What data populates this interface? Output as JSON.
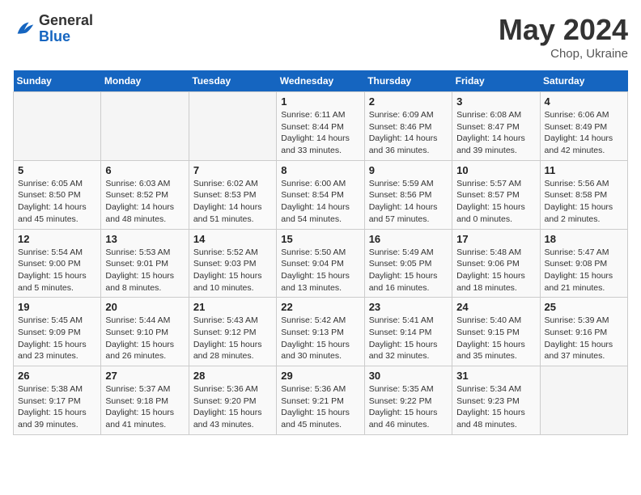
{
  "logo": {
    "line1": "General",
    "line2": "Blue"
  },
  "title": "May 2024",
  "location": "Chop, Ukraine",
  "weekdays": [
    "Sunday",
    "Monday",
    "Tuesday",
    "Wednesday",
    "Thursday",
    "Friday",
    "Saturday"
  ],
  "weeks": [
    [
      {
        "day": "",
        "info": ""
      },
      {
        "day": "",
        "info": ""
      },
      {
        "day": "",
        "info": ""
      },
      {
        "day": "1",
        "info": "Sunrise: 6:11 AM\nSunset: 8:44 PM\nDaylight: 14 hours\nand 33 minutes."
      },
      {
        "day": "2",
        "info": "Sunrise: 6:09 AM\nSunset: 8:46 PM\nDaylight: 14 hours\nand 36 minutes."
      },
      {
        "day": "3",
        "info": "Sunrise: 6:08 AM\nSunset: 8:47 PM\nDaylight: 14 hours\nand 39 minutes."
      },
      {
        "day": "4",
        "info": "Sunrise: 6:06 AM\nSunset: 8:49 PM\nDaylight: 14 hours\nand 42 minutes."
      }
    ],
    [
      {
        "day": "5",
        "info": "Sunrise: 6:05 AM\nSunset: 8:50 PM\nDaylight: 14 hours\nand 45 minutes."
      },
      {
        "day": "6",
        "info": "Sunrise: 6:03 AM\nSunset: 8:52 PM\nDaylight: 14 hours\nand 48 minutes."
      },
      {
        "day": "7",
        "info": "Sunrise: 6:02 AM\nSunset: 8:53 PM\nDaylight: 14 hours\nand 51 minutes."
      },
      {
        "day": "8",
        "info": "Sunrise: 6:00 AM\nSunset: 8:54 PM\nDaylight: 14 hours\nand 54 minutes."
      },
      {
        "day": "9",
        "info": "Sunrise: 5:59 AM\nSunset: 8:56 PM\nDaylight: 14 hours\nand 57 minutes."
      },
      {
        "day": "10",
        "info": "Sunrise: 5:57 AM\nSunset: 8:57 PM\nDaylight: 15 hours\nand 0 minutes."
      },
      {
        "day": "11",
        "info": "Sunrise: 5:56 AM\nSunset: 8:58 PM\nDaylight: 15 hours\nand 2 minutes."
      }
    ],
    [
      {
        "day": "12",
        "info": "Sunrise: 5:54 AM\nSunset: 9:00 PM\nDaylight: 15 hours\nand 5 minutes."
      },
      {
        "day": "13",
        "info": "Sunrise: 5:53 AM\nSunset: 9:01 PM\nDaylight: 15 hours\nand 8 minutes."
      },
      {
        "day": "14",
        "info": "Sunrise: 5:52 AM\nSunset: 9:03 PM\nDaylight: 15 hours\nand 10 minutes."
      },
      {
        "day": "15",
        "info": "Sunrise: 5:50 AM\nSunset: 9:04 PM\nDaylight: 15 hours\nand 13 minutes."
      },
      {
        "day": "16",
        "info": "Sunrise: 5:49 AM\nSunset: 9:05 PM\nDaylight: 15 hours\nand 16 minutes."
      },
      {
        "day": "17",
        "info": "Sunrise: 5:48 AM\nSunset: 9:06 PM\nDaylight: 15 hours\nand 18 minutes."
      },
      {
        "day": "18",
        "info": "Sunrise: 5:47 AM\nSunset: 9:08 PM\nDaylight: 15 hours\nand 21 minutes."
      }
    ],
    [
      {
        "day": "19",
        "info": "Sunrise: 5:45 AM\nSunset: 9:09 PM\nDaylight: 15 hours\nand 23 minutes."
      },
      {
        "day": "20",
        "info": "Sunrise: 5:44 AM\nSunset: 9:10 PM\nDaylight: 15 hours\nand 26 minutes."
      },
      {
        "day": "21",
        "info": "Sunrise: 5:43 AM\nSunset: 9:12 PM\nDaylight: 15 hours\nand 28 minutes."
      },
      {
        "day": "22",
        "info": "Sunrise: 5:42 AM\nSunset: 9:13 PM\nDaylight: 15 hours\nand 30 minutes."
      },
      {
        "day": "23",
        "info": "Sunrise: 5:41 AM\nSunset: 9:14 PM\nDaylight: 15 hours\nand 32 minutes."
      },
      {
        "day": "24",
        "info": "Sunrise: 5:40 AM\nSunset: 9:15 PM\nDaylight: 15 hours\nand 35 minutes."
      },
      {
        "day": "25",
        "info": "Sunrise: 5:39 AM\nSunset: 9:16 PM\nDaylight: 15 hours\nand 37 minutes."
      }
    ],
    [
      {
        "day": "26",
        "info": "Sunrise: 5:38 AM\nSunset: 9:17 PM\nDaylight: 15 hours\nand 39 minutes."
      },
      {
        "day": "27",
        "info": "Sunrise: 5:37 AM\nSunset: 9:18 PM\nDaylight: 15 hours\nand 41 minutes."
      },
      {
        "day": "28",
        "info": "Sunrise: 5:36 AM\nSunset: 9:20 PM\nDaylight: 15 hours\nand 43 minutes."
      },
      {
        "day": "29",
        "info": "Sunrise: 5:36 AM\nSunset: 9:21 PM\nDaylight: 15 hours\nand 45 minutes."
      },
      {
        "day": "30",
        "info": "Sunrise: 5:35 AM\nSunset: 9:22 PM\nDaylight: 15 hours\nand 46 minutes."
      },
      {
        "day": "31",
        "info": "Sunrise: 5:34 AM\nSunset: 9:23 PM\nDaylight: 15 hours\nand 48 minutes."
      },
      {
        "day": "",
        "info": ""
      }
    ]
  ]
}
